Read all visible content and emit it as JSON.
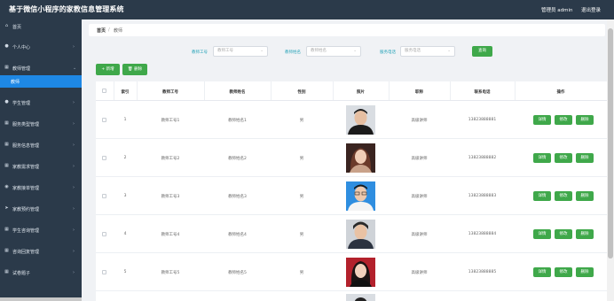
{
  "header": {
    "title": "基于微信小程序的家教信息管理系统",
    "user": "管理员 admin",
    "logout": "退出登录"
  },
  "sidebar": {
    "items": [
      {
        "label": "首页",
        "icon": "home-icon",
        "has_arrow": false
      },
      {
        "label": "个人中心",
        "icon": "user-icon",
        "has_arrow": true
      },
      {
        "label": "教师管理",
        "icon": "grid-icon",
        "has_arrow": true
      },
      {
        "label": "教师",
        "icon": "",
        "has_arrow": false,
        "active": true
      },
      {
        "label": "学生管理",
        "icon": "user-icon",
        "has_arrow": true
      },
      {
        "label": "服务类型管理",
        "icon": "grid-icon",
        "has_arrow": true
      },
      {
        "label": "服务信息管理",
        "icon": "grid-icon",
        "has_arrow": true
      },
      {
        "label": "家教需求管理",
        "icon": "grid-icon",
        "has_arrow": true
      },
      {
        "label": "家教接单管理",
        "icon": "chat-icon",
        "has_arrow": true
      },
      {
        "label": "家教预约管理",
        "icon": "send-icon",
        "has_arrow": true
      },
      {
        "label": "学生咨询管理",
        "icon": "grid-icon",
        "has_arrow": true
      },
      {
        "label": "咨询回复管理",
        "icon": "grid-icon",
        "has_arrow": true
      },
      {
        "label": "试卷题子",
        "icon": "grid-icon",
        "has_arrow": true
      }
    ]
  },
  "breadcrumb": {
    "home": "首页",
    "separator": "/",
    "current": "教师"
  },
  "search": {
    "fields": [
      {
        "label": "教师工号",
        "placeholder": "教师工号"
      },
      {
        "label": "教师姓名",
        "placeholder": "教师姓名"
      },
      {
        "label": "服务电话",
        "placeholder": "服务电话"
      }
    ],
    "button": "查询"
  },
  "toolbar": {
    "add": "+ 新增",
    "delete": "🗑 删除"
  },
  "table": {
    "headers": [
      "索引",
      "教师工号",
      "教师姓名",
      "性别",
      "照片",
      "职称",
      "联系电话",
      "操作"
    ],
    "rows": [
      {
        "index": "1",
        "no": "教师工号1",
        "name": "教师姓名1",
        "gender": "男",
        "title": "高级讲师",
        "phone": "13823888881"
      },
      {
        "index": "2",
        "no": "教师工号2",
        "name": "教师姓名2",
        "gender": "男",
        "title": "高级讲师",
        "phone": "13823888882"
      },
      {
        "index": "3",
        "no": "教师工号3",
        "name": "教师姓名3",
        "gender": "男",
        "title": "高级讲师",
        "phone": "13823888883"
      },
      {
        "index": "4",
        "no": "教师工号4",
        "name": "教师姓名4",
        "gender": "男",
        "title": "高级讲师",
        "phone": "13823888884"
      },
      {
        "index": "5",
        "no": "教师工号5",
        "name": "教师姓名5",
        "gender": "男",
        "title": "高级讲师",
        "phone": "13823888885"
      }
    ],
    "actions": [
      "详情",
      "修改",
      "删除"
    ]
  },
  "colors": {
    "sidebar": "#2b3a4a",
    "accent": "#3fa84a",
    "active": "#1e88e5",
    "label": "#27a3b8"
  }
}
